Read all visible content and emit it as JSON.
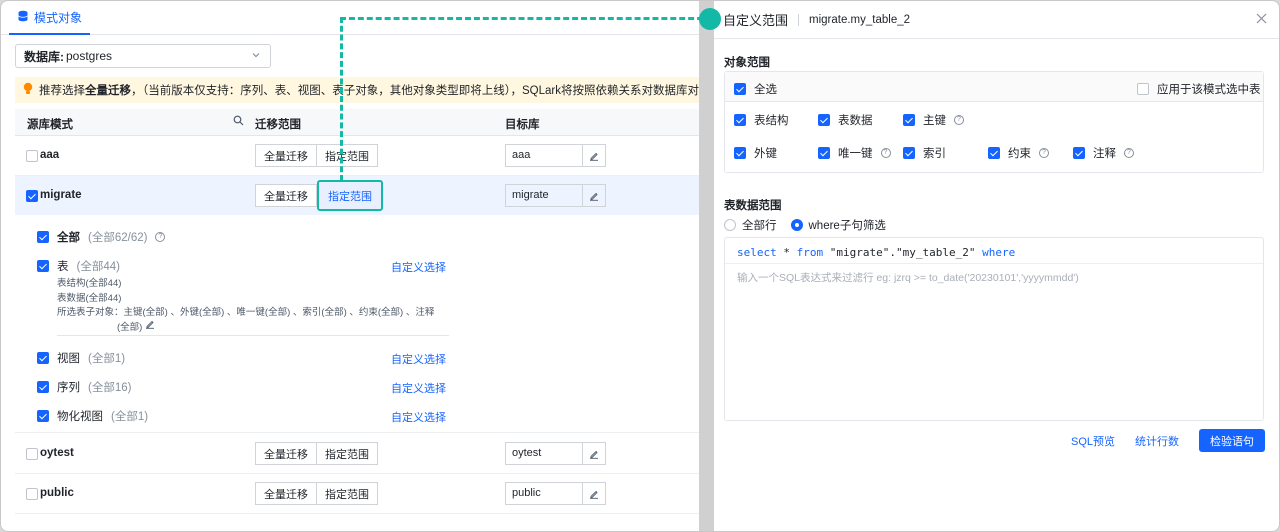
{
  "left": {
    "tab_label": "模式对象",
    "db_select": {
      "label": "数据库:",
      "value": "postgres"
    },
    "notice": {
      "prefix": "推荐选择",
      "bold": "全量迁移",
      "rest": "，（当前版本仅支持：序列、表、视图、表子对象，其他对象类型即将上线），SQLark将按照依赖关系对数据库对象实施自动化迁移"
    },
    "headers": {
      "source": "源库模式",
      "scope": "迁移范围",
      "target": "目标库"
    },
    "buttons": {
      "full": "全量迁移",
      "custom": "指定范围"
    },
    "rows": [
      {
        "name": "aaa",
        "target": "aaa",
        "checked": false
      },
      {
        "name": "migrate",
        "target": "migrate",
        "checked": true
      },
      {
        "name": "oytest",
        "target": "oytest",
        "checked": false
      },
      {
        "name": "public",
        "target": "public",
        "checked": false
      }
    ],
    "sub": {
      "all_label": "全部",
      "all_count": "(全部62/62)",
      "table_label": "表",
      "table_count": "(全部44)",
      "table_struct": "表结构(全部44)",
      "table_data": "表数据(全部44)",
      "subobjects_line1": "所选表子对象：主键(全部) 、外键(全部) 、唯一键(全部) 、索引(全部) 、约束(全部) 、注释",
      "subobjects_line2": "(全部)",
      "view_label": "视图",
      "view_count": "(全部1)",
      "seq_label": "序列",
      "seq_count": "(全部16)",
      "mview_label": "物化视图",
      "mview_count": "(全部1)",
      "custom_link": "自定义选择"
    }
  },
  "right": {
    "title": "自定义范围",
    "table": "migrate.my_table_2",
    "object_scope_title": "对象范围",
    "select_all": "全选",
    "apply_all": "应用于该模式选中表",
    "options": {
      "struct": "表结构",
      "data": "表数据",
      "pk": "主键",
      "fk": "外键",
      "unique": "唯一键",
      "index": "索引",
      "constraint": "约束",
      "comment": "注释"
    },
    "data_scope_title": "表数据范围",
    "radio_all": "全部行",
    "radio_where": "where子句筛选",
    "sql": {
      "select": "select",
      "star": " * ",
      "from": "from",
      "table": " \"migrate\".\"my_table_2\" ",
      "where": "where"
    },
    "placeholder": "输入一个SQL表达式来过滤行 eg:  jzrq >= to_date('20230101','yyyymmdd')",
    "footer": {
      "preview": "SQL预览",
      "count": "统计行数",
      "validate": "检验语句"
    }
  },
  "colors": {
    "accent": "#1664ff",
    "highlight": "#13b8a6",
    "notice_bg": "#fff7e0"
  }
}
